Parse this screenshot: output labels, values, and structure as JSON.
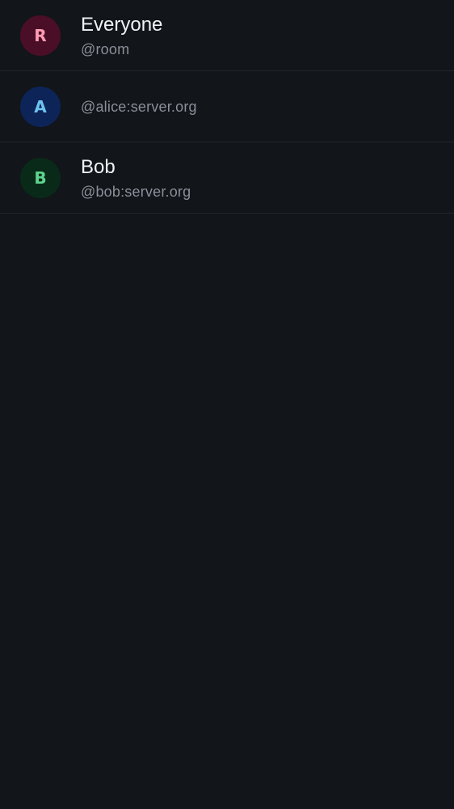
{
  "mention_suggestions": [
    {
      "initial": "R",
      "display_name": "Everyone",
      "handle": "@room",
      "avatar_bg": "#4a0f26",
      "avatar_fg": "#ff9bb3"
    },
    {
      "initial": "A",
      "display_name": "",
      "handle": "@alice:server.org",
      "avatar_bg": "#0d2458",
      "avatar_fg": "#6fc3f0"
    },
    {
      "initial": "B",
      "display_name": "Bob",
      "handle": "@bob:server.org",
      "avatar_bg": "#0a2a19",
      "avatar_fg": "#5fd38e"
    }
  ],
  "colors": {
    "background": "#121519",
    "divider": "#22262c",
    "name_text": "#f1f3f5",
    "handle_text": "#8a9099"
  }
}
